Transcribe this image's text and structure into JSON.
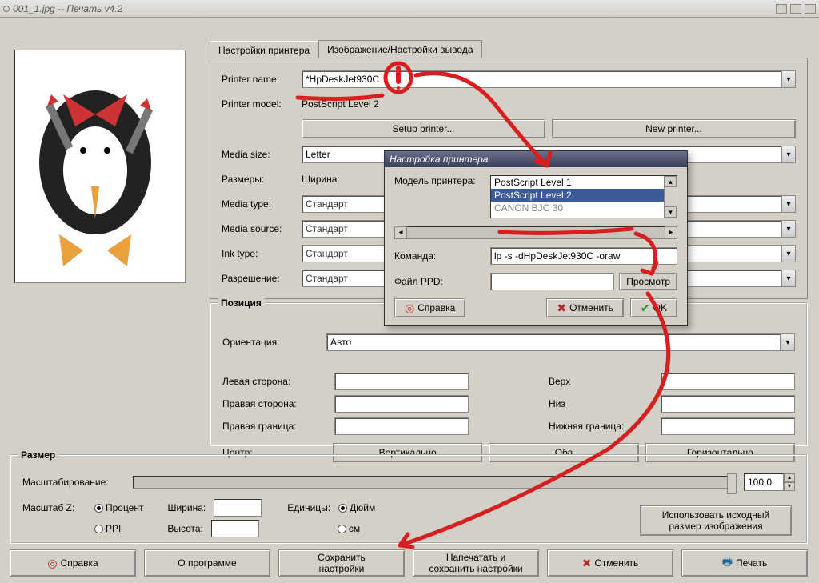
{
  "window": {
    "title": "001_1.jpg -- Печать v4.2"
  },
  "tabs": {
    "printer_settings": "Настройки принтера",
    "image_output": "Изображение/Настройки вывода"
  },
  "printer": {
    "name_label": "Printer name:",
    "name_value": "*HpDeskJet930C",
    "model_label": "Printer model:",
    "model_value": "PostScript Level 2",
    "setup_btn": "Setup printer...",
    "new_btn": "New printer...",
    "media_size_label": "Media size:",
    "media_size_value": "Letter",
    "dimensions_label": "Размеры:",
    "width_label": "Ширина:",
    "media_type_label": "Media type:",
    "media_type_value": "Стандарт",
    "media_source_label": "Media source:",
    "media_source_value": "Стандарт",
    "ink_type_label": "Ink type:",
    "ink_type_value": "Стандарт",
    "resolution_label": "Разрешение:",
    "resolution_value": "Стандарт"
  },
  "position": {
    "legend": "Позиция",
    "orientation_label": "Ориентация:",
    "orientation_value": "Авто",
    "left_label": "Левая сторона:",
    "right_label": "Правая сторона:",
    "right_border_label": "Правая граница:",
    "top_label": "Верх",
    "bottom_label": "Низ",
    "bottom_border_label": "Нижняя граница:",
    "center_label": "Центр:",
    "vert_btn": "Вертикально",
    "both_btn": "Оба",
    "horiz_btn": "Горизонтально"
  },
  "size": {
    "legend": "Размер",
    "scaling_label": "Масштабирование:",
    "scaling_value": "100,0",
    "scale_z_label": "Масштаб Z:",
    "percent": "Процент",
    "ppi": "PPI",
    "width_label": "Ширина:",
    "height_label": "Высота:",
    "units_label": "Единицы:",
    "inch": "Дюйм",
    "cm": "см",
    "use_original": "Использовать исходный размер изображения"
  },
  "footer": {
    "help": "Справка",
    "about": "О программе",
    "save_settings": "Сохранить\nнастройки",
    "print_and_save": "Напечатать и\nсохранить настройки",
    "cancel": "Отменить",
    "print": "Печать"
  },
  "popup": {
    "title": "Настройка принтера",
    "model_label": "Модель принтера:",
    "models": [
      "PostScript Level 1",
      "PostScript Level 2",
      "CANON BJC 30"
    ],
    "selected_index": 1,
    "cmd_label": "Команда:",
    "cmd_value": "lp -s -dHpDeskJet930C -oraw",
    "ppd_label": "Файл PPD:",
    "ppd_value": "",
    "browse": "Просмотр",
    "help": "Справка",
    "cancel": "Отменить",
    "ok": "OK"
  }
}
